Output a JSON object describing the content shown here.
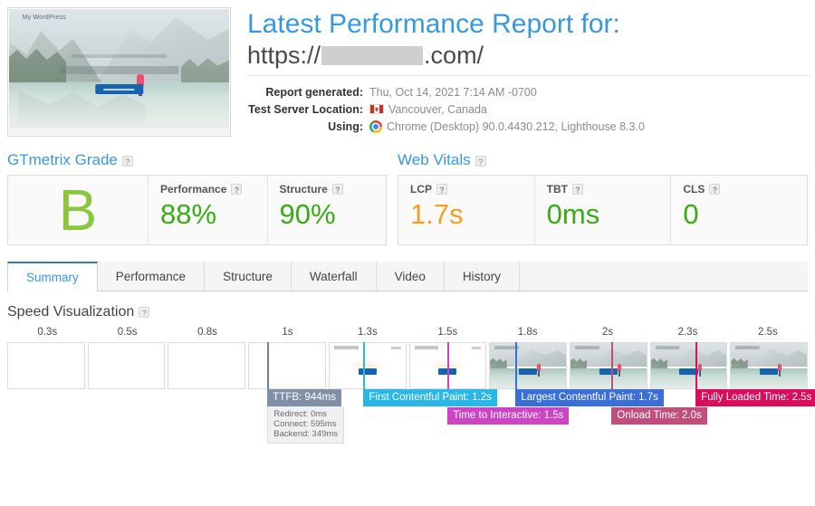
{
  "header": {
    "title": "Latest Performance Report for:",
    "url_scheme": "https://",
    "url_suffix": ".com/",
    "thumbnail": {
      "site_name": "My WordPress",
      "cta_label": ""
    },
    "meta": [
      {
        "label": "Report generated:",
        "value": "Thu, Oct 14, 2021 7:14 AM -0700",
        "icon": ""
      },
      {
        "label": "Test Server Location:",
        "value": "Vancouver, Canada",
        "icon": "canada-flag-icon"
      },
      {
        "label": "Using:",
        "value": "Chrome (Desktop) 90.0.4430.212, Lighthouse 8.3.0",
        "icon": "chrome-icon"
      }
    ]
  },
  "grade_panel": {
    "title": "GTmetrix Grade",
    "help": "?",
    "grade": "B",
    "metrics": [
      {
        "label": "Performance",
        "value": "88%",
        "help": "?"
      },
      {
        "label": "Structure",
        "value": "90%",
        "help": "?"
      }
    ]
  },
  "vitals_panel": {
    "title": "Web Vitals",
    "help": "?",
    "metrics": [
      {
        "label": "LCP",
        "value": "1.7s",
        "help": "?",
        "color": "#f3a01c"
      },
      {
        "label": "TBT",
        "value": "0ms",
        "help": "?",
        "color": "#3aab14"
      },
      {
        "label": "CLS",
        "value": "0",
        "help": "?",
        "color": "#3aab14"
      }
    ]
  },
  "tabs": [
    {
      "label": "Summary",
      "active": true
    },
    {
      "label": "Performance",
      "active": false
    },
    {
      "label": "Structure",
      "active": false
    },
    {
      "label": "Waterfall",
      "active": false
    },
    {
      "label": "Video",
      "active": false
    },
    {
      "label": "History",
      "active": false
    }
  ],
  "speed_visualization": {
    "title": "Speed Visualization",
    "help": "?",
    "ticks": [
      "0.3s",
      "0.5s",
      "0.8s",
      "1s",
      "1.3s",
      "1.5s",
      "1.8s",
      "2s",
      "2.3s",
      "2.5s"
    ],
    "events": [
      {
        "name": "ttfb",
        "label": "TTFB: 944ms",
        "color": "#7f8fa6",
        "marker_color": "#6d7ea0",
        "left_pct": 32.5,
        "label_left_pct": 32.5
      },
      {
        "name": "fcp",
        "label": "First Contentful Paint: 1.2s",
        "color": "#29b6e8",
        "marker_color": "#29b6e8",
        "left_pct": 44.5,
        "label_left_pct": 44.5
      },
      {
        "name": "tti",
        "label": "Time to Interactive: 1.5s",
        "color": "#cc44c4",
        "marker_color": "#cc44c4",
        "left_pct": 55.0,
        "label_left_pct": 55.0
      },
      {
        "name": "lcp",
        "label": "Largest Contentful Paint: 1.7s",
        "color": "#3a6fd8",
        "marker_color": "#3a6fd8",
        "left_pct": 63.5,
        "label_left_pct": 63.5
      },
      {
        "name": "onload",
        "label": "Onload Time: 2.0s",
        "color": "#c14f7d",
        "marker_color": "#c14f7d",
        "left_pct": 75.5,
        "label_left_pct": 75.5
      },
      {
        "name": "fully-loaded",
        "label": "Fully Loaded Time: 2.5s",
        "color": "#d90d5a",
        "marker_color": "#d90d5a",
        "left_pct": 86.0,
        "label_left_pct": 86.0
      }
    ],
    "ttfb_breakdown": [
      "Redirect: 0ms",
      "Connect: 595ms",
      "Backend: 349ms"
    ]
  }
}
